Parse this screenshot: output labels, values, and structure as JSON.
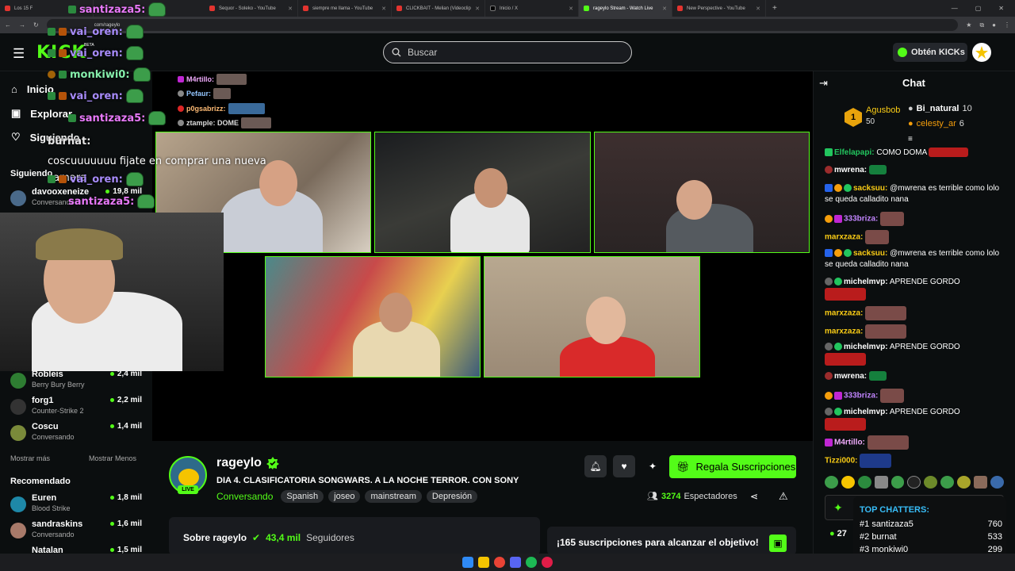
{
  "browser": {
    "tabs": [
      {
        "label": "Los 15 F"
      },
      {
        "label": "Sequor - Soleko - YouTube"
      },
      {
        "label": "siempre me llama - YouTube"
      },
      {
        "label": "CLICKBAIT - Melian (Videoclip"
      },
      {
        "label": "Inicio / X"
      },
      {
        "label": "rageylo Stream - Watch Live"
      },
      {
        "label": "New Perspective - YouTube"
      }
    ],
    "url": "com/rageylo"
  },
  "topnav": {
    "logo": "KICK",
    "logo_tag": "BETA",
    "search_placeholder": "Buscar",
    "kicks_button": "Obtén KICKs"
  },
  "sidebar": {
    "nav": [
      {
        "label": "Inicio",
        "icon": "home-icon"
      },
      {
        "label": "Explorar",
        "icon": "compass-icon"
      },
      {
        "label": "Siguiendo",
        "icon": "heart-icon"
      }
    ],
    "following_header": "Siguiendo",
    "following": [
      {
        "name": "davooxeneize",
        "sub": "Conversando",
        "viewers": "19,8 mil"
      },
      {
        "name": "Robleis",
        "sub": "Berry Bury Berry",
        "viewers": "2,4 mil"
      },
      {
        "name": "forg1",
        "sub": "Counter-Strike 2",
        "viewers": "2,2 mil"
      },
      {
        "name": "Coscu",
        "sub": "Conversando",
        "viewers": "1,4 mil"
      }
    ],
    "show_more": "Mostrar más",
    "show_less": "Mostrar Menos",
    "recommended_header": "Recomendado",
    "recommended": [
      {
        "name": "Euren",
        "sub": "Blood Strike",
        "viewers": "1,8 mil"
      },
      {
        "name": "sandraskins",
        "sub": "Conversando",
        "viewers": "1,6 mil"
      },
      {
        "name": "Natalan",
        "sub": "",
        "viewers": "1,5 mil"
      }
    ]
  },
  "overlay_chat": [
    {
      "user": "santizaza5:",
      "color": "#e879f9"
    },
    {
      "user": "vai_oren:",
      "color": "#a78bfa"
    },
    {
      "user": "vai_oren:",
      "color": "#a78bfa"
    },
    {
      "user": "monkiwi0:",
      "color": "#86efac"
    },
    {
      "user": "vai_oren:",
      "color": "#a78bfa"
    },
    {
      "user": "santizaza5:",
      "color": "#e879f9"
    }
  ],
  "overlay_msg": {
    "user": "burnat:",
    "text": "coscuuuuuuu fijate en comprar una nueva camara"
  },
  "overlay_after": [
    {
      "user": "vai_oren:",
      "color": "#a78bfa"
    },
    {
      "user": "santizaza5:",
      "color": "#e879f9"
    }
  ],
  "small_overlay": [
    {
      "user": "M4rtillo:",
      "color": "#f0abfc"
    },
    {
      "user": "Pefaur:",
      "color": "#93c5fd"
    },
    {
      "user": "p0gsabrizz:",
      "color": "#fdba74"
    },
    {
      "user": "ztample: DOME",
      "color": "#e5e5e5"
    }
  ],
  "stream": {
    "channel": "rageylo",
    "title": "DIA 4. CLASIFICATORIA SONGWARS. A LA NOCHE TERROR. CON SONY",
    "category": "Conversando",
    "tags": [
      "Spanish",
      "joseo",
      "mainstream",
      "Depresión"
    ],
    "live": "LIVE",
    "viewers": "3274",
    "viewers_label": "Espectadores",
    "subscribe_button": "Regala Suscripciones",
    "about_title": "Sobre rageylo",
    "followers": "43,4 mil",
    "followers_label": "Seguidores",
    "goal_text": "¡165 suscripciones para alcanzar el objetivo!"
  },
  "chat": {
    "title": "Chat",
    "top_gifters": [
      {
        "rank": "1",
        "name": "Agusbob",
        "count": "50"
      },
      {
        "name": "Bi_natural",
        "count": "10"
      },
      {
        "name": "celesty_ar",
        "count": "6"
      }
    ],
    "messages": [
      {
        "user": "Elfelapapi:",
        "color": "#22c55e",
        "text": "COMO DOMA"
      },
      {
        "user": "mwrena:",
        "color": "#ffffff",
        "text": ""
      },
      {
        "user": "sacksuu:",
        "color": "#facc15",
        "text": "@mwrena es terrible como lolo se queda calladito nana"
      },
      {
        "user": "333briza:",
        "color": "#c084fc",
        "text": ""
      },
      {
        "user": "marxzaza:",
        "color": "#facc15",
        "text": ""
      },
      {
        "user": "sacksuu:",
        "color": "#facc15",
        "text": "@mwrena es terrible como lolo se queda calladito nana"
      },
      {
        "user": "michelmvp:",
        "color": "#ffffff",
        "text": "APRENDE GORDO"
      },
      {
        "user": "marxzaza:",
        "color": "#facc15",
        "text": ""
      },
      {
        "user": "marxzaza:",
        "color": "#facc15",
        "text": ""
      },
      {
        "user": "michelmvp:",
        "color": "#ffffff",
        "text": "APRENDE GORDO"
      },
      {
        "user": "mwrena:",
        "color": "#ffffff",
        "text": ""
      },
      {
        "user": "333briza:",
        "color": "#c084fc",
        "text": ""
      },
      {
        "user": "michelmvp:",
        "color": "#ffffff",
        "text": "APRENDE GORDO"
      },
      {
        "user": "M4rtillo:",
        "color": "#f0abfc",
        "text": ""
      },
      {
        "user": "Tizzi000:",
        "color": "#facc15",
        "text": ""
      }
    ],
    "top_chatters_title": "TOP CHATTERS:",
    "top_chatters": [
      {
        "rank": "#1",
        "name": "santizaza5",
        "count": "760"
      },
      {
        "rank": "#2",
        "name": "burnat",
        "count": "533"
      },
      {
        "rank": "#3",
        "name": "monkiwi0",
        "count": "299"
      }
    ],
    "balance": "27"
  },
  "colors": {
    "accent": "#53fc18",
    "bg": "#0b0e0f",
    "panel": "#191b1f"
  }
}
